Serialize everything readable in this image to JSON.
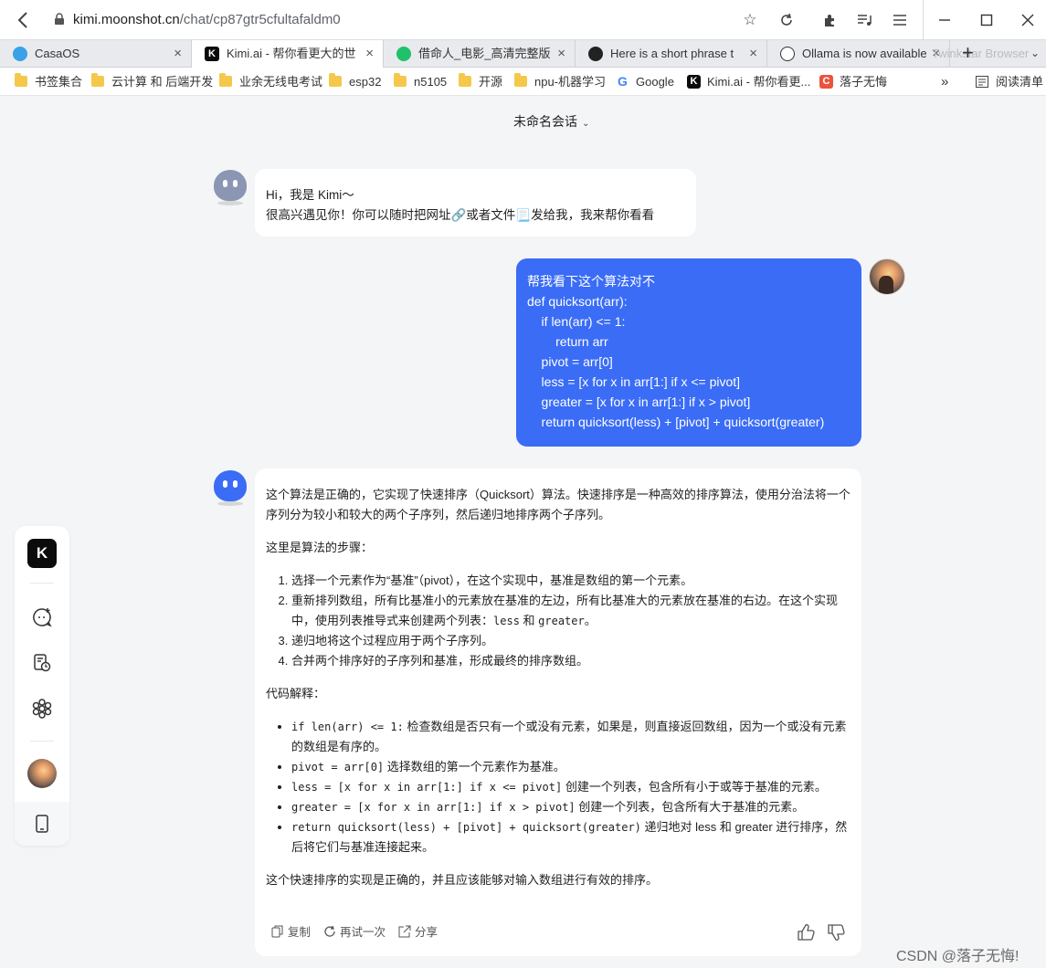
{
  "browser": {
    "url_host": "kimi.moonshot.cn",
    "url_path": "/chat/cp87gtr5cfultafaldm0",
    "tabs": [
      {
        "label": "CasaOS",
        "close": "×"
      },
      {
        "label": "Kimi.ai - 帮你看更大的世",
        "close": "×"
      },
      {
        "label": "借命人_电影_高清完整版",
        "close": "×"
      },
      {
        "label": "Here is a short phrase t",
        "close": "×"
      },
      {
        "label": "Ollama is now available",
        "close": "×"
      }
    ],
    "new_tab": "+",
    "ghost_label": "Twinkstar Browser",
    "tab_overflow": "⌄",
    "bookmarks": [
      "书签集合",
      "云计算 和 后端开发",
      "业余无线电考试",
      "esp32",
      "n5105",
      "开源",
      "npu-机器学习",
      "Google",
      "Kimi.ai - 帮你看更...",
      "落子无悔"
    ],
    "bookmarks_more": "»",
    "reading_list": "阅读清单"
  },
  "chat": {
    "title": "未命名会话",
    "greeting_line1": "Hi，我是 Kimi～",
    "greeting_line2": "很高兴遇见你！你可以随时把网址🔗或者文件📃发给我，我来帮你看看",
    "user_message": "帮我看下这个算法对不\ndef quicksort(arr):\n    if len(arr) <= 1:\n        return arr\n    pivot = arr[0]\n    less = [x for x in arr[1:] if x <= pivot]\n    greater = [x for x in arr[1:] if x > pivot]\n    return quicksort(less) + [pivot] + quicksort(greater)",
    "answer": {
      "intro": "这个算法是正确的，它实现了快速排序（Quicksort）算法。快速排序是一种高效的排序算法，使用分治法将一个序列分为较小和较大的两个子序列，然后递归地排序两个子序列。",
      "steps_title": "这里是算法的步骤：",
      "steps": [
        "选择一个元素作为“基准”（pivot），在这个实现中，基准是数组的第一个元素。",
        "重新排列数组，所有比基准小的元素放在基准的左边，所有比基准大的元素放在基准的右边。在这个实现中，使用列表推导式来创建两个列表：",
        "递归地将这个过程应用于两个子序列。",
        "合并两个排序好的子序列和基准，形成最终的排序数组。"
      ],
      "step2_code1": "less",
      "step2_and": " 和 ",
      "step2_code2": "greater",
      "step2_end": "。",
      "code_title": "代码解释：",
      "bullets": [
        {
          "code": "if len(arr) <= 1:",
          "text": " 检查数组是否只有一个或没有元素，如果是，则直接返回数组，因为一个或没有元素的数组是有序的。"
        },
        {
          "code": "pivot = arr[0]",
          "text": " 选择数组的第一个元素作为基准。"
        },
        {
          "code": "less = [x for x in arr[1:] if x <= pivot]",
          "text": " 创建一个列表，包含所有小于或等于基准的元素。"
        },
        {
          "code": "greater = [x for x in arr[1:] if x > pivot]",
          "text": " 创建一个列表，包含所有大于基准的元素。"
        },
        {
          "code": "return quicksort(less) + [pivot] + quicksort(greater)",
          "text": " 递归地对 less 和 greater 进行排序，然后将它们与基准连接起来。"
        }
      ],
      "conclusion": "这个快速排序的实现是正确的，并且应该能够对输入数组进行有效的排序。",
      "copy": "复制",
      "retry": "再试一次",
      "share": "分享"
    }
  },
  "sidebar": {
    "logo": "K"
  },
  "watermark": "CSDN @落子无悔!",
  "colors": {
    "user_bubble": "#3a6cf6",
    "bot_avatar_1": "#8a96b3",
    "bot_avatar_2": "#3a6cf6"
  }
}
